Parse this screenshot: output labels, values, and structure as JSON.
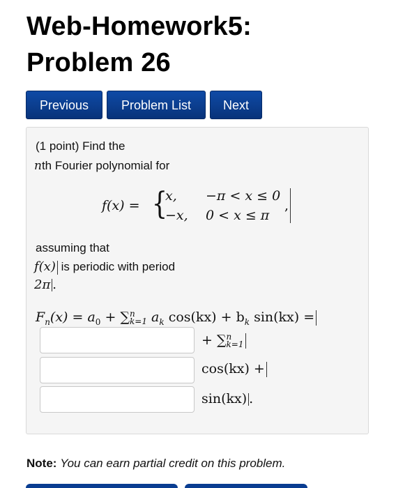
{
  "header": {
    "title_line1": "Web-Homework5:",
    "title_line2": "Problem 26"
  },
  "nav": {
    "previous_label": "Previous",
    "problem_list_label": "Problem List",
    "next_label": "Next"
  },
  "problem": {
    "intro_line1": "(1 point) Find the",
    "intro_line2_var": "n",
    "intro_line2_rest": "th Fourier polynomial for",
    "f_label": "f(x) =",
    "case1_value": "x,",
    "case1_condition": "−π < x ≤ 0",
    "case2_value": "−x,",
    "case2_condition": "0 < x ≤ π",
    "case_trailing": ",",
    "assuming_text": "assuming that",
    "periodic_fx": "f(x)",
    "periodic_text": "is periodic with period",
    "period_value": "2π",
    "period_end": ".",
    "fourier_lhs": "F",
    "fourier_lhs_sub": "n",
    "fourier_lhs_rest": "(x) = a",
    "a0_sub": "0",
    "plus_sum": "+ ∑",
    "sum_sup": "n",
    "sum_sub": "k=1",
    "ak": "a",
    "ak_sub": "k",
    "cos_kx": "cos(kx) + b",
    "bk_sub": "k",
    "sin_kx_eq": "sin(kx) =",
    "row2_plus_sum": "+ ∑",
    "row2_sup": "n",
    "row2_sub": "k=1",
    "row3_cos": "cos(kx) +",
    "row4_sin": "sin(kx)",
    "row4_end": "."
  },
  "inputs": [
    {
      "value": ""
    },
    {
      "value": ""
    },
    {
      "value": ""
    }
  ],
  "footer": {
    "note_label": "Note:",
    "note_text": "You can earn partial credit on this problem."
  },
  "colors": {
    "button_bg": "#0a3d91",
    "panel_bg": "#f5f5f5"
  }
}
